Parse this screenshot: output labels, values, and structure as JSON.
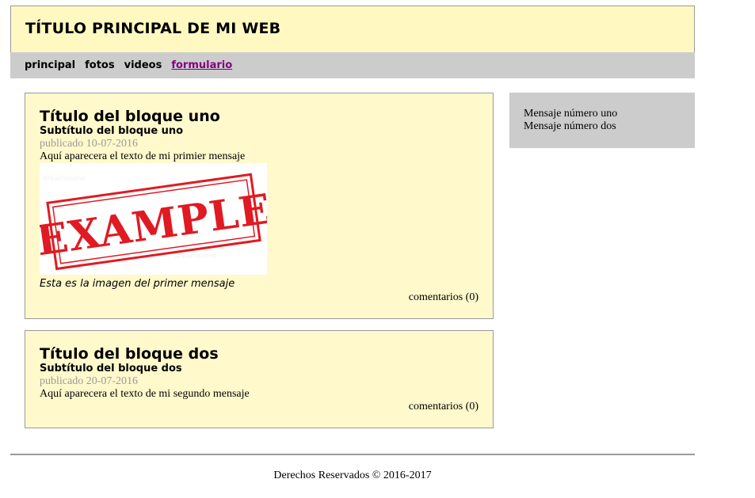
{
  "header": {
    "title": "TÍTULO PRINCIPAL DE MI WEB"
  },
  "nav": {
    "items": [
      {
        "label": "principal"
      },
      {
        "label": "fotos"
      },
      {
        "label": "videos"
      },
      {
        "label": "formulario"
      }
    ]
  },
  "posts": [
    {
      "title": "Título del bloque uno",
      "subtitle": "Subtítulo del bloque uno",
      "date": "publicado 10-07-2016",
      "text": "Aquí aparecera el texto de mi primier mensaje",
      "image": {
        "stamp_text": "EXAMPLE",
        "stamp_color": "#e01a22"
      },
      "caption": "Esta es la imagen del primer mensaje",
      "comments": "comentarios (0)"
    },
    {
      "title": "Título del bloque dos",
      "subtitle": "Subtítulo del bloque dos",
      "date": "publicado 20-07-2016",
      "text": "Aquí aparecera el texto de mi segundo mensaje",
      "comments": "comentarios (0)"
    }
  ],
  "sidebar": {
    "messages": [
      "Mensaje número uno",
      "Mensaje número dos"
    ]
  },
  "footer": {
    "text": "Derechos Reservados © 2016-2017"
  },
  "colors": {
    "header_bg": "#fff9c1",
    "post_bg": "#fff9cc",
    "nav_bg": "#cccccc",
    "visited_link": "#800080"
  }
}
